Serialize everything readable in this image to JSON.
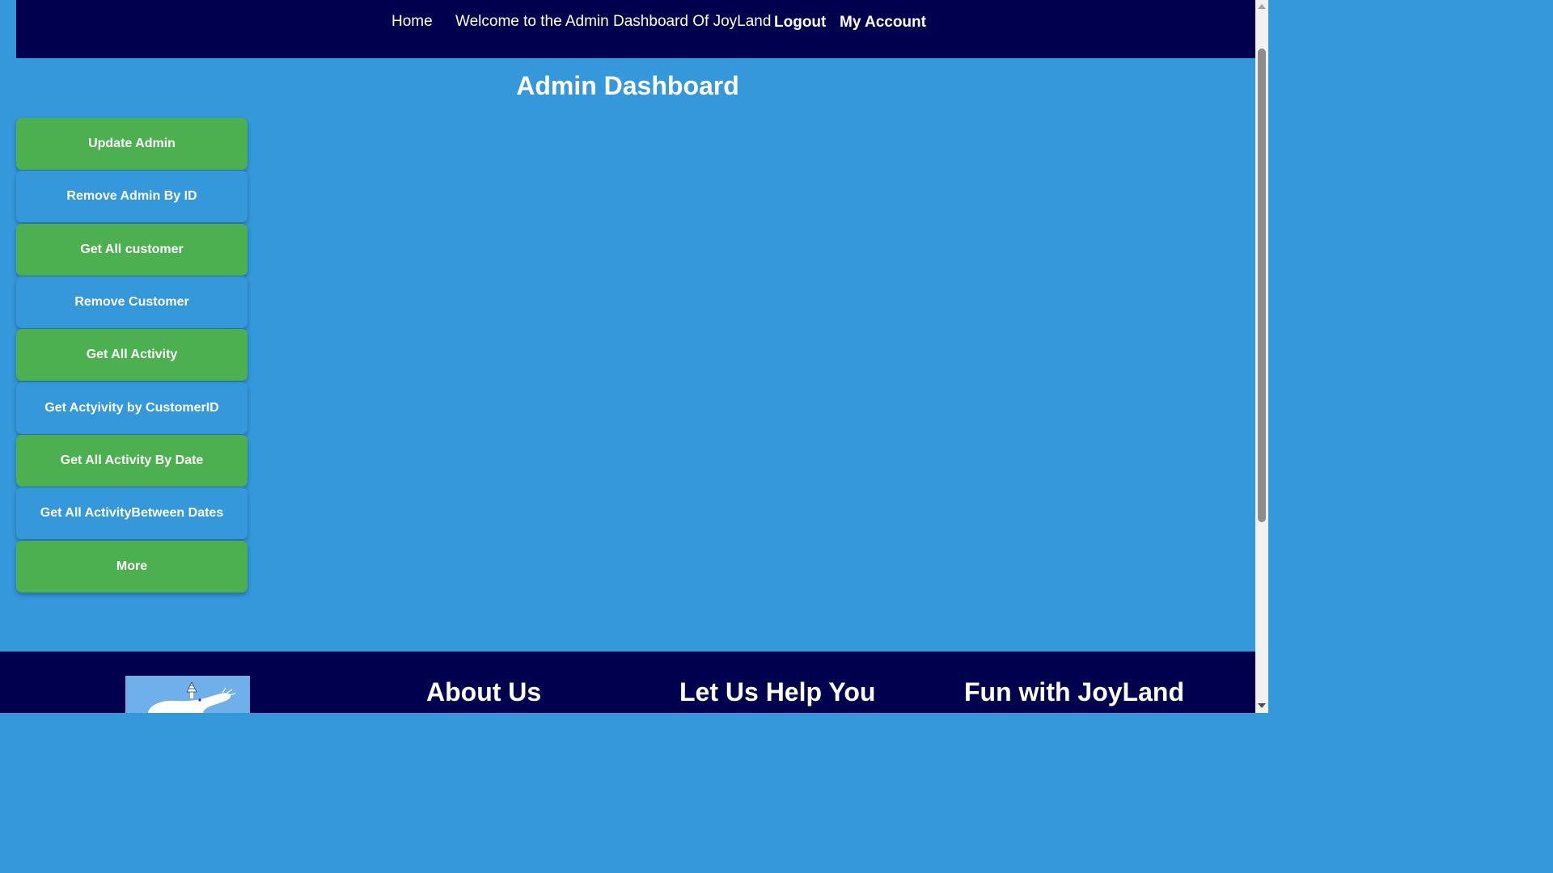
{
  "nav": {
    "home_label": "Home",
    "welcome_text": "Welcome to the Admin Dashboard Of JoyLand",
    "logout_label": "Logout",
    "account_label": "My Account"
  },
  "main": {
    "title": "Admin Dashboard"
  },
  "menu": {
    "items": [
      {
        "label": "Update Admin",
        "color": "#4caf50"
      },
      {
        "label": "Remove Admin By ID",
        "color": "#3498db"
      },
      {
        "label": "Get All customer",
        "color": "#4caf50"
      },
      {
        "label": "Remove Customer",
        "color": "#3498db"
      },
      {
        "label": "Get All Activity",
        "color": "#4caf50"
      },
      {
        "label": "Get Actyivity by CustomerID",
        "color": "#3498db"
      },
      {
        "label": "Get All Activity By Date",
        "color": "#4caf50"
      },
      {
        "label": "Get All ActivityBetween Dates",
        "color": "#3498db"
      },
      {
        "label": "More",
        "color": "#4caf50"
      }
    ]
  },
  "footer": {
    "about_heading": "About Us",
    "help_heading": "Let Us Help You",
    "fun_heading": "Fun with JoyLand"
  },
  "colors": {
    "navbar": "#00004f",
    "page_background": "#3498db",
    "button_green": "#4caf50",
    "button_blue": "#3498db"
  }
}
